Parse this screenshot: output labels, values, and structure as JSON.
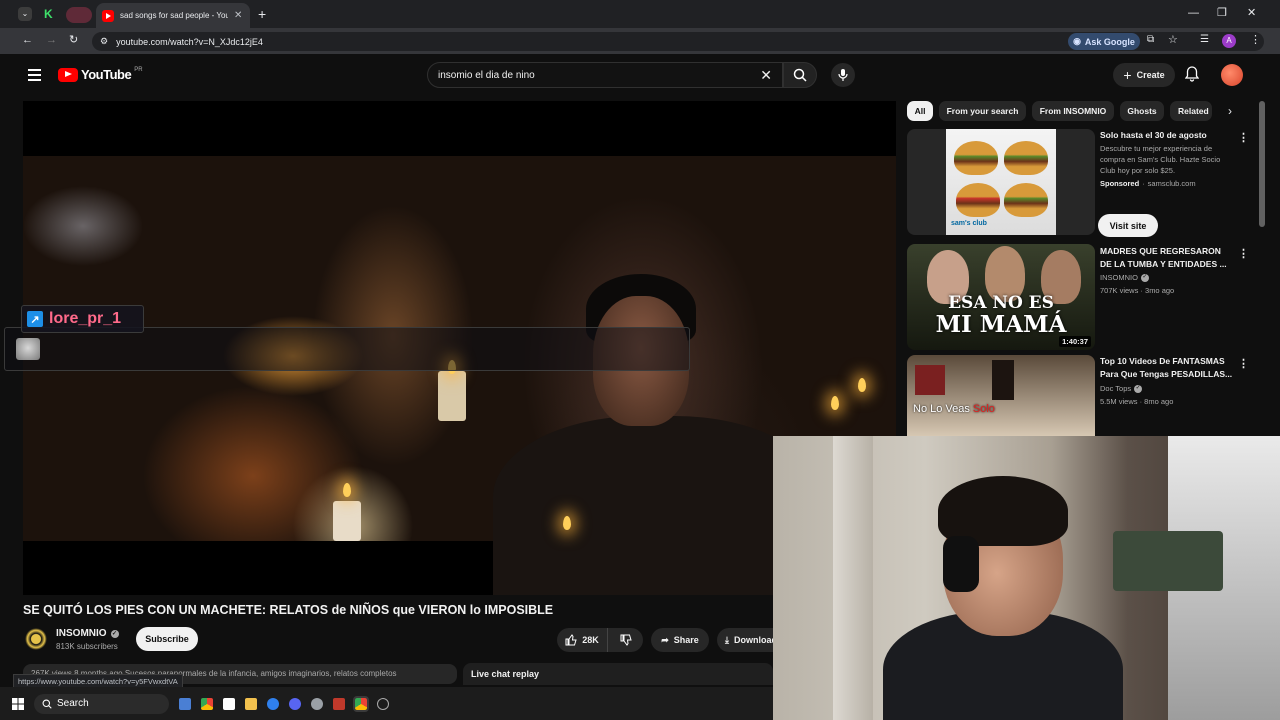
{
  "browser": {
    "tab_title": "sad songs for sad people - YouTube",
    "url": "youtube.com/watch?v=N_XJdc12jE4",
    "ask_google": "Ask Google",
    "profile_initial": "A"
  },
  "youtube": {
    "logo_text": "YouTube",
    "country_code": "PR",
    "search_value": "insomio el dia de nino",
    "create_label": "Create"
  },
  "overlay_chat": {
    "username": "lore_pr_1"
  },
  "video": {
    "title": "SE QUITÓ LOS PIES CON UN MACHETE: RELATOS de NIÑOS que VIERON lo IMPOSIBLE",
    "channel_name": "INSOMNIO",
    "subscribers": "813K subscribers",
    "subscribe_label": "Subscribe",
    "likes": "28K",
    "share_label": "Share",
    "download_label": "Download",
    "description_snippet": "267K views  8 months ago  Sucesos paranormales de la infancia, amigos imaginarios, relatos completos",
    "live_chat_replay": "Live chat replay",
    "status_url": "https://www.youtube.com/watch?v=y5FVwxdtVA"
  },
  "sidebar": {
    "chips": [
      "All",
      "From your search",
      "From INSOMNIO",
      "Ghosts",
      "Related"
    ],
    "ad": {
      "title": "Solo hasta el 30 de agosto",
      "description": "Descubre tu mejor experiencia de compra en Sam's Club. Hazte Socio Club hoy por solo $25.",
      "sponsored": "Sponsored",
      "domain": "samsclub.com",
      "visit_label": "Visit site",
      "thumb_brand": "sam's club"
    },
    "videos": [
      {
        "title": "MADRES QUE REGRESARON DE LA TUMBA Y ENTIDADES ...",
        "channel": "INSOMNIO",
        "meta": "707K views · 3mo ago",
        "duration": "1:40:37",
        "thumb_text_1": "ESA NO ES",
        "thumb_text_2": "MI MAMÁ"
      },
      {
        "title": "Top 10 Videos De FANTASMAS Para Que Tengas PESADILLAS...",
        "channel": "Doc Tops",
        "meta": "5.5M views · 8mo ago",
        "thumb_text_1": "No Lo Veas",
        "thumb_text_2": "Solo"
      }
    ]
  },
  "taskbar": {
    "search_label": "Search"
  },
  "colors": {
    "youtube_red": "#ff0000",
    "background": "#0f0f0f",
    "chat_name": "#ff6a8a"
  }
}
